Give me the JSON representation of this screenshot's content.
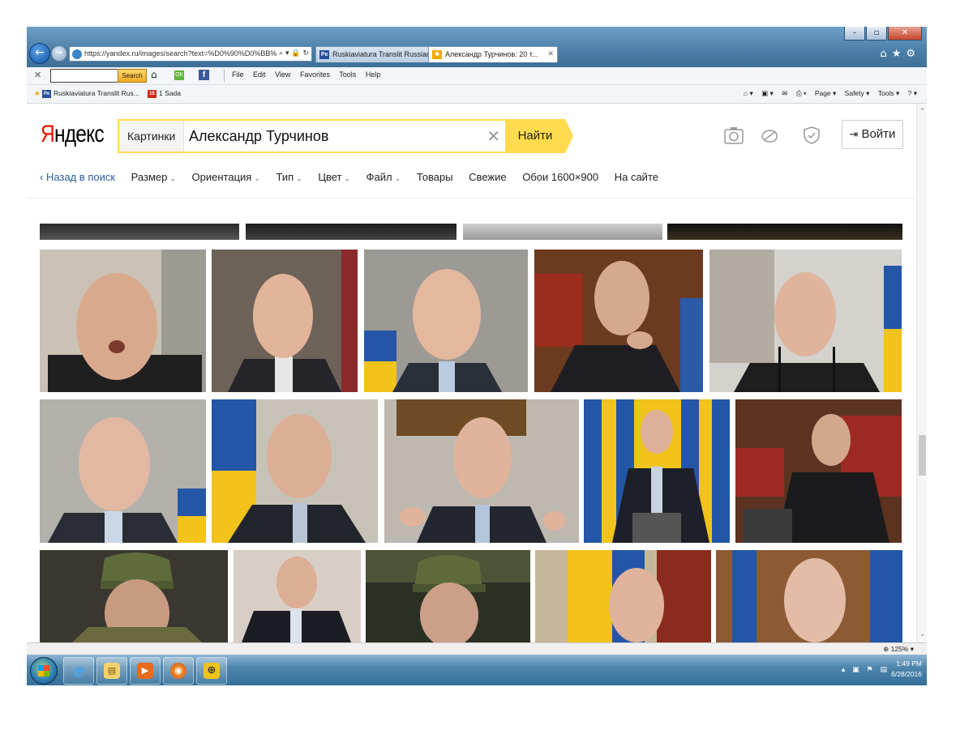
{
  "browser": {
    "address": "https://yandex.ru/images/search?text=%D0%90%D0%BB%D0%B5",
    "tabs": [
      {
        "label": "Ruskiaviatura Translit Russian",
        "icon": "Pк"
      },
      {
        "label": "Александр Турчинов: 20 т...",
        "icon": "Y"
      }
    ],
    "search_button": "Search",
    "ok_icon_label": "ОК",
    "fb_icon_label": "f",
    "menu": [
      "File",
      "Edit",
      "View",
      "Favorites",
      "Tools",
      "Help"
    ],
    "favorites": [
      {
        "label": "Ruskiaviatura Translit Rus...",
        "icon": "Pк",
        "color": "#2a4f9a"
      },
      {
        "label": "1 Sada",
        "icon": "15",
        "color": "#cc2a1a"
      }
    ],
    "command_bar": [
      "Page ▾",
      "Safety ▾",
      "Tools ▾"
    ]
  },
  "yandex": {
    "logo_y": "Я",
    "logo_rest": "ндекс",
    "search_scope": "Картинки",
    "search_value": "Александр Турчинов",
    "find_button": "Найти",
    "login_button": "Войти",
    "filters": {
      "back": "‹ Назад в поиск",
      "size": "Размер",
      "orientation": "Ориентация",
      "type": "Тип",
      "color": "Цвет",
      "file": "Файл",
      "goods": "Товары",
      "fresh": "Свежие",
      "wallpapers": "Обои 1600×900",
      "on_site": "На сайте"
    }
  },
  "status": {
    "zoom": "125%"
  },
  "taskbar": {
    "time": "1:49 PM",
    "date": "6/28/2016"
  },
  "colors": {
    "yandex_yellow": "#ffdb4d",
    "yandex_red": "#e61400",
    "link_blue": "#2b5c9a"
  }
}
